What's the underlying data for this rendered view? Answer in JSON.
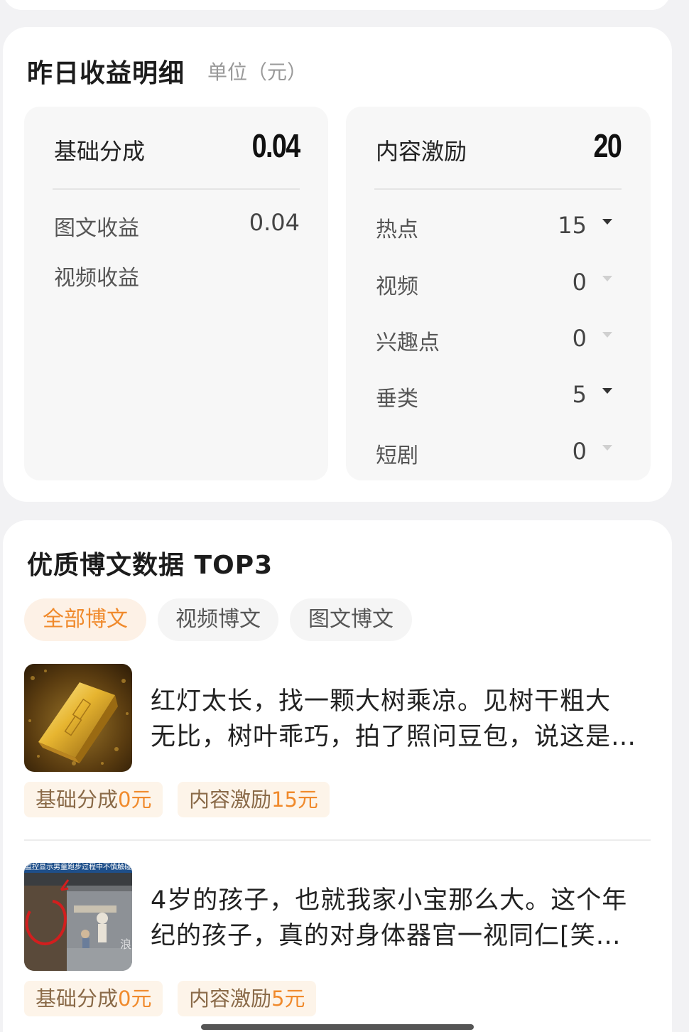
{
  "earnings": {
    "title": "昨日收益明细",
    "unit": "单位（元）",
    "base": {
      "label": "基础分成",
      "value": "0.04",
      "rows": [
        {
          "label": "图文收益",
          "value": "0.04"
        },
        {
          "label": "视频收益",
          "value": ""
        }
      ]
    },
    "incentive": {
      "label": "内容激励",
      "value": "20",
      "rows": [
        {
          "label": "热点",
          "value": "15",
          "expanded": true
        },
        {
          "label": "视频",
          "value": "0",
          "expanded": false
        },
        {
          "label": "兴趣点",
          "value": "0",
          "expanded": false
        },
        {
          "label": "垂类",
          "value": "5",
          "expanded": true
        },
        {
          "label": "短剧",
          "value": "0",
          "expanded": false
        }
      ]
    }
  },
  "top3": {
    "title": "优质博文数据 TOP3",
    "tabs": [
      {
        "label": "全部博文",
        "active": true
      },
      {
        "label": "视频博文",
        "active": false
      },
      {
        "label": "图文博文",
        "active": false
      }
    ],
    "posts": [
      {
        "line1": "红灯太长，找一颗大树乘凉。见树干粗大",
        "line2": "无比，树叶乖巧，拍了照问豆包，说这是…",
        "base_label": "基础分成",
        "base_amount": "0元",
        "incentive_label": "内容激励",
        "incentive_amount": "15元",
        "thumb_icon": "gold-bar-image"
      },
      {
        "line1": "4岁的孩子，也就我家小宝那么大。这个年",
        "line2": "纪的孩子，真的对身体器官一视同仁[笑…",
        "base_label": "基础分成",
        "base_amount": "0元",
        "incentive_label": "内容激励",
        "incentive_amount": "5元",
        "thumb_icon": "video-still-image",
        "thumb_caption": "监控显示男童跑步过程中不慎触碰"
      }
    ]
  },
  "colors": {
    "accent": "#f08a2c",
    "tag_bg": "#fdf4e9",
    "tab_active_bg": "#fdf1e6"
  }
}
